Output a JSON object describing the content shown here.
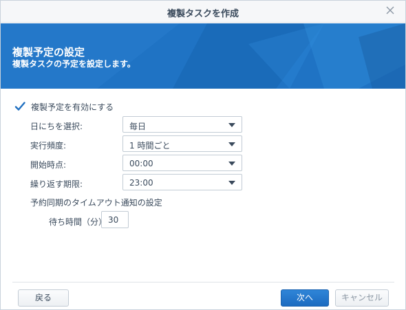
{
  "window": {
    "title": "複製タスクを作成"
  },
  "banner": {
    "title": "複製予定の設定",
    "subtitle": "複製タスクの予定を設定します。"
  },
  "schedule": {
    "enable_label": "複製予定を有効にする",
    "enabled": true,
    "fields": [
      {
        "label": "日にちを選択:",
        "value": "毎日"
      },
      {
        "label": "実行頻度:",
        "value": "1 時間ごと"
      },
      {
        "label": "開始時点:",
        "value": "00:00"
      },
      {
        "label": "繰り返す期限:",
        "value": "23:00"
      }
    ],
    "timeout_section": "予約同期のタイムアウト通知の設定",
    "wait_label": "待ち時間（分）",
    "wait_value": "30"
  },
  "footer": {
    "back_label": "戻る",
    "next_label": "次へ",
    "cancel_label": "キャンセル"
  },
  "colors": {
    "accent": "#1f73c4",
    "check": "#1f6fc0"
  }
}
